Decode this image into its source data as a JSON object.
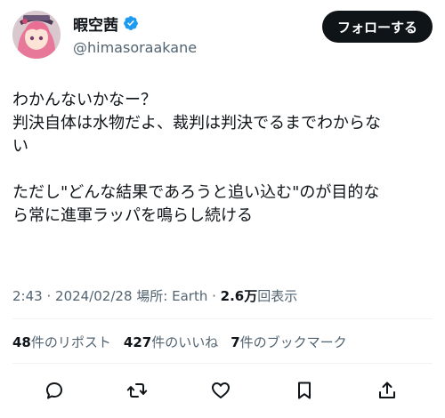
{
  "author": {
    "display_name": "暇空茜",
    "handle": "@himasoraakane",
    "verified_color": "#1d9bf0"
  },
  "follow_button": {
    "label": "フォローする"
  },
  "tweet": {
    "lines": [
      "わかんないかなー？",
      "判決自体は水物だよ、裁判は判決でるまでわからな",
      "い",
      "",
      "ただし\"どんな結果であろうと追い込む\"のが目的な",
      "ら常に進軍ラッパを鳴らし続ける"
    ]
  },
  "meta": {
    "time": "2:43",
    "date": "2024/02/28",
    "location": "場所: Earth",
    "views_count": "2.6万",
    "views_label": "回表示",
    "separator": "·"
  },
  "stats": {
    "reposts_count": "48",
    "reposts_label": "件のリポスト",
    "likes_count": "427",
    "likes_label": "件のいいね",
    "bookmarks_count": "7",
    "bookmarks_label": "件のブックマーク"
  },
  "actions": [
    "reply-icon",
    "repost-icon",
    "like-icon",
    "bookmark-icon",
    "share-icon"
  ]
}
